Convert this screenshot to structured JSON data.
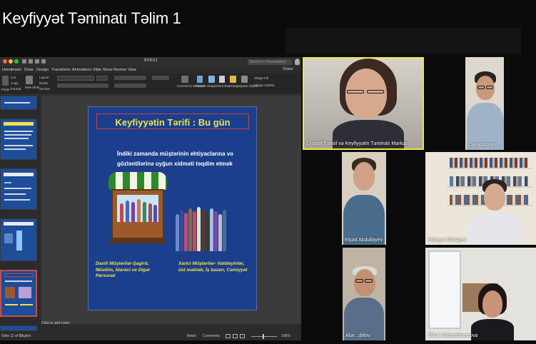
{
  "meeting": {
    "title": "Keyfiyyət Təminatı Təlim 1"
  },
  "powerpoint": {
    "doc_name": "8YKVJ",
    "search_placeholder": "Search in Presentation",
    "share_label": "Share",
    "tabs": [
      "Home",
      "Insert",
      "Draw",
      "Design",
      "Transitions",
      "Animations",
      "Slide Show",
      "Review",
      "View"
    ],
    "ribbon": {
      "paste_label": "Paste",
      "cut_label": "Cut",
      "copy_label": "Copy",
      "format_label": "Format",
      "new_slide_label": "New Slide",
      "layout_label": "Layout",
      "reset_label": "Reset",
      "section_label": "Section",
      "convert_label": "Convert to SmartArt",
      "picture_label": "Picture",
      "shapes_label": "Shapes",
      "textbox_label": "Text Box",
      "arrange_label": "Arrange",
      "quick_styles_label": "Quick Styles",
      "shape_fill_label": "Shape Fill",
      "shape_outline_label": "Shape Outline"
    },
    "notes_placeholder": "Click to add notes",
    "status": {
      "slide_counter": "Slide 11 of 17",
      "language": "English",
      "notes_button": "Notes",
      "comments_button": "Comments",
      "zoom": "106%"
    },
    "slide": {
      "title": "Keyfiyyətin Tərifi : Bu gün",
      "body_line1": "İndiki zamanda müştərinin ehtiyaclarına və",
      "body_line2": "gözləntilərinə uyğun xidməti təqdim etmək",
      "internal_label": "Daxili Müştərilər-Şagird, Müəllim, İdarəci və Digər Personal",
      "external_label": "Xarici Müştərilər- Valideyinlər, üst məktəb, İş bazarı, Cəmiyyət"
    },
    "thumbnails": [
      {
        "index": 7
      },
      {
        "index": 8
      },
      {
        "index": 9
      },
      {
        "index": 10
      },
      {
        "index": 11,
        "title": "Keyfiyyətin Tərifi : Bu gün",
        "active": true
      }
    ]
  },
  "participants": [
    {
      "name": "Distant Təhsil və Keyfiyyətin Təminatı Mərkəzi",
      "speaking": true
    },
    {
      "name": "Camil Məmm..."
    },
    {
      "name": "Elşad Abdullayev"
    },
    {
      "name": "Hüseyn Mirzəyev"
    },
    {
      "name": "Afər...diifov"
    },
    {
      "name": "Ülkər Abdurahmanova"
    }
  ],
  "colors": {
    "slide_bg": "#1b3f8c",
    "slide_title": "#f2e24a",
    "slide_title_border": "#c4453f",
    "app_bg": "#0b0b0b"
  },
  "icons": [
    "undo-icon",
    "redo-icon",
    "save-icon",
    "user-icon",
    "zoom-slider-icon"
  ]
}
